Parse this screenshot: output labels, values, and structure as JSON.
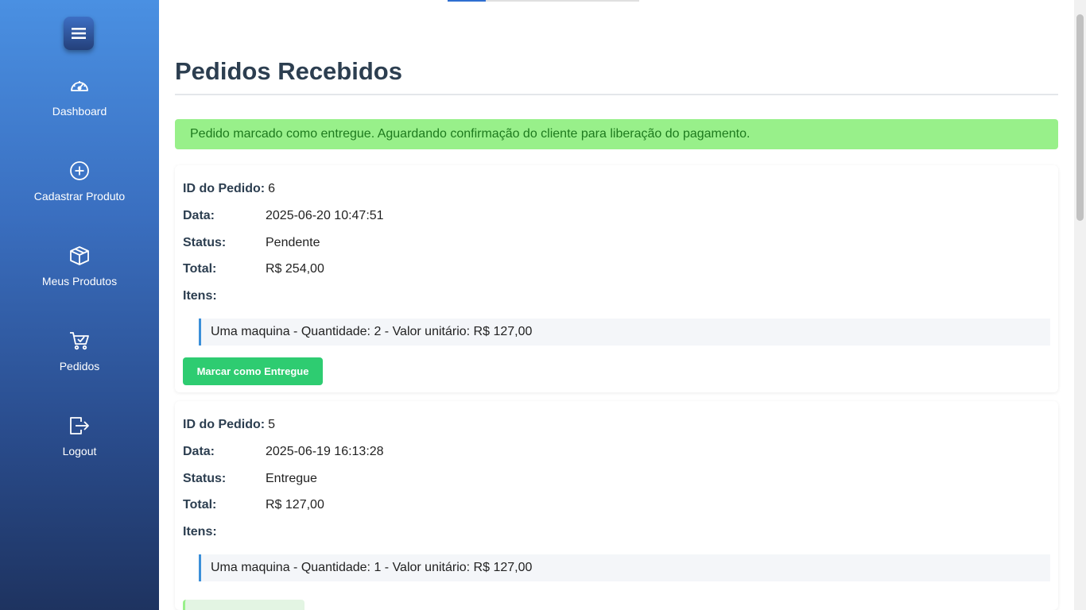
{
  "sidebar": {
    "toggle_icon": "hamburger-menu-icon",
    "items": [
      {
        "label": "Dashboard",
        "icon": "speedometer-icon"
      },
      {
        "label": "Cadastrar Produto",
        "icon": "plus-circle-icon"
      },
      {
        "label": "Meus Produtos",
        "icon": "box-icon"
      },
      {
        "label": "Pedidos",
        "icon": "cart-check-icon"
      },
      {
        "label": "Logout",
        "icon": "logout-icon"
      }
    ]
  },
  "page": {
    "title": "Pedidos Recebidos",
    "alert": "Pedido marcado como entregue. Aguardando confirmação do cliente para liberação do pagamento."
  },
  "labels": {
    "id": "ID do Pedido:",
    "date": "Data:",
    "status": "Status:",
    "total": "Total:",
    "items": "Itens:"
  },
  "orders": [
    {
      "id": "6",
      "date": "2025-06-20 10:47:51",
      "status": "Pendente",
      "total": "R$ 254,00",
      "items": [
        "Uma maquina - Quantidade: 2 - Valor unitário: R$ 127,00"
      ],
      "action_label": "Marcar como Entregue"
    },
    {
      "id": "5",
      "date": "2025-06-19 16:13:28",
      "status": "Entregue",
      "total": "R$ 127,00",
      "items": [
        "Uma maquina - Quantidade: 1 - Valor unitário: R$ 127,00"
      ]
    }
  ],
  "colors": {
    "accent": "#2ecc71",
    "alert_bg": "#98f08a",
    "sidebar_top": "#4a90e2",
    "sidebar_bottom": "#1e3360"
  }
}
